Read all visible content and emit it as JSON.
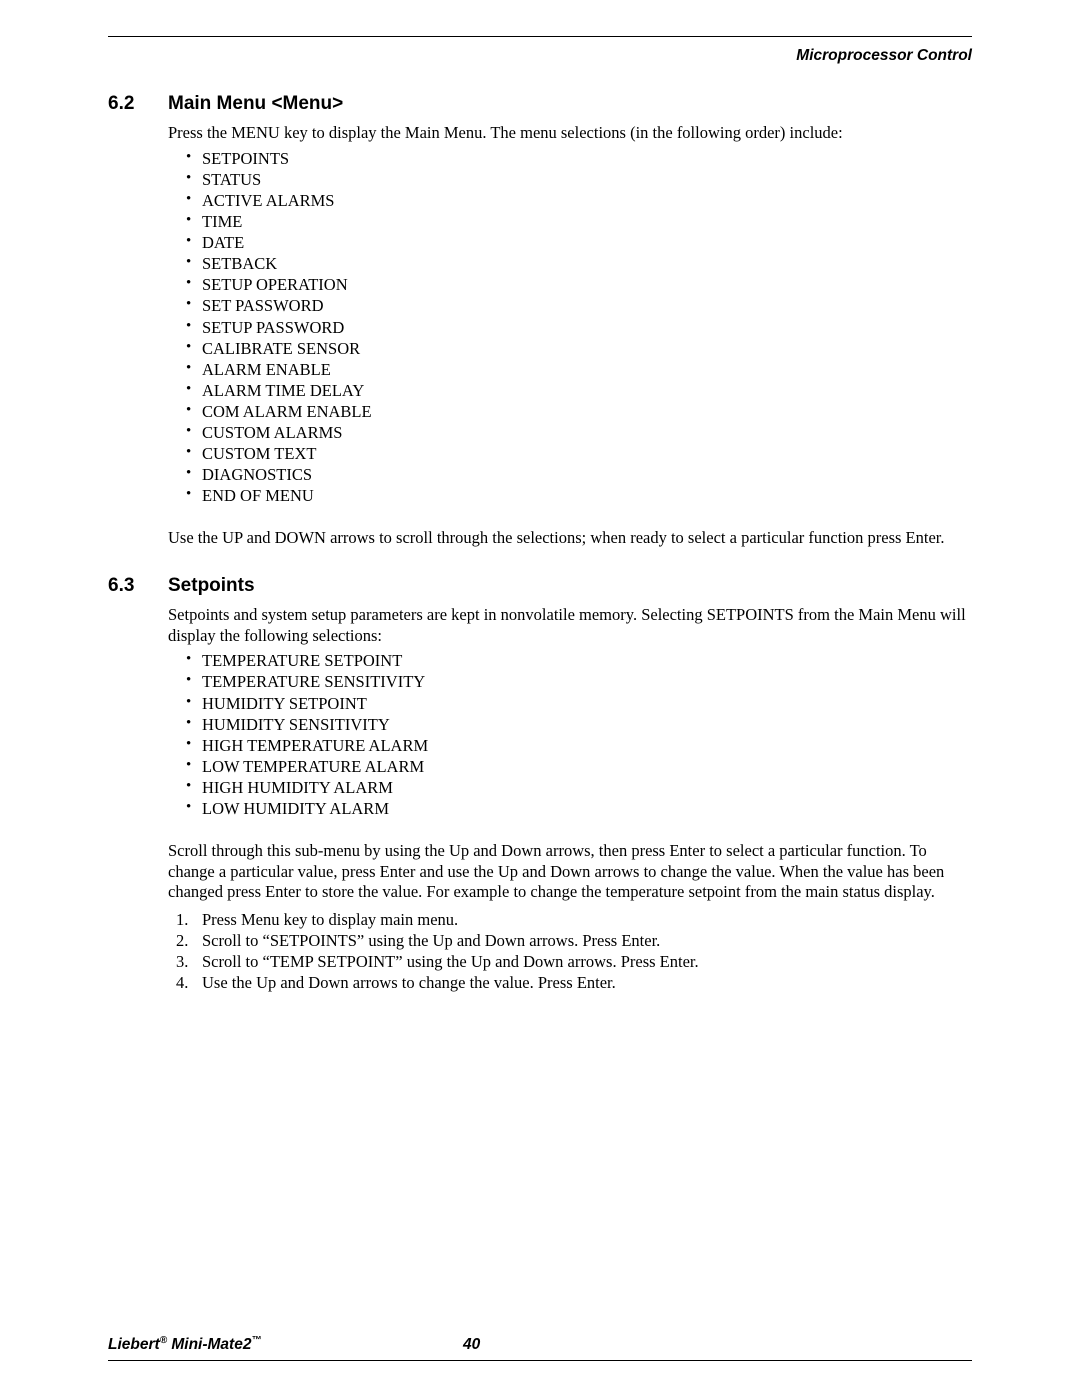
{
  "running_head": "Microprocessor Control",
  "section62": {
    "num": "6.2",
    "title": "Main Menu <Menu>",
    "intro": "Press the MENU key to display the Main Menu. The menu selections (in the following order) include:",
    "items": [
      "SETPOINTS",
      "STATUS",
      "ACTIVE ALARMS",
      "TIME",
      "DATE",
      "SETBACK",
      "SETUP OPERATION",
      "SET PASSWORD",
      "SETUP PASSWORD",
      "CALIBRATE SENSOR",
      "ALARM ENABLE",
      "ALARM TIME DELAY",
      "COM ALARM ENABLE",
      "CUSTOM ALARMS",
      "CUSTOM TEXT",
      "DIAGNOSTICS",
      "END OF MENU"
    ],
    "outro": "Use the UP and DOWN arrows to scroll through the selections; when ready to select a particular function press Enter."
  },
  "section63": {
    "num": "6.3",
    "title": "Setpoints",
    "intro": "Setpoints and system setup parameters are kept in nonvolatile memory. Selecting SETPOINTS from the Main Menu will display the following selections:",
    "items": [
      "TEMPERATURE SETPOINT",
      "TEMPERATURE SENSITIVITY",
      "HUMIDITY SETPOINT",
      "HUMIDITY SENSITIVITY",
      "HIGH TEMPERATURE ALARM",
      "LOW TEMPERATURE ALARM",
      "HIGH HUMIDITY ALARM",
      "LOW HUMIDITY ALARM"
    ],
    "para2": "Scroll through this sub-menu by using the Up and Down arrows, then press Enter to select a particular function. To change a particular value, press Enter and use the Up and Down arrows to change the value. When the value has been changed press Enter to store the value. For example to change the temperature setpoint from the main status display.",
    "steps": [
      "Press Menu key to display main menu.",
      "Scroll to “SETPOINTS” using the Up and Down arrows. Press Enter.",
      "Scroll to “TEMP SETPOINT” using the Up and Down arrows. Press Enter.",
      "Use the Up and Down arrows to change the value. Press Enter."
    ]
  },
  "footer": {
    "product_prefix": "Liebert",
    "product_suffix": " Mini-Mate2",
    "reg": "®",
    "tm": "™",
    "page": "40"
  }
}
